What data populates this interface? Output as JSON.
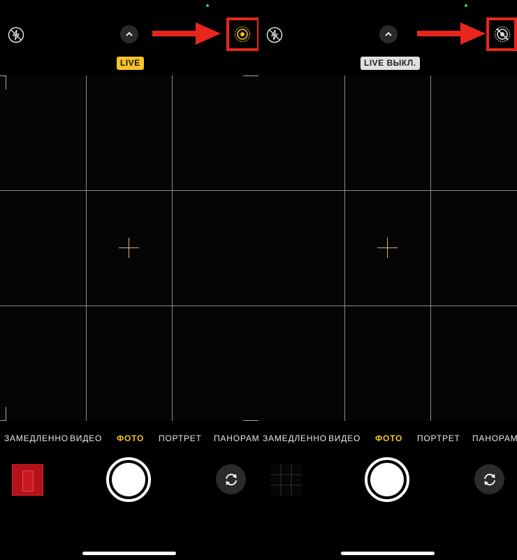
{
  "left": {
    "live_badge": "LIVE",
    "modes": [
      "ЗАМЕДЛЕННО",
      "ВИДЕО",
      "ФОТО",
      "ПОРТРЕТ",
      "ПАНОРАМА"
    ],
    "active_mode": "ФОТО"
  },
  "right": {
    "live_badge": "LIVE ВЫКЛ.",
    "modes": [
      "ЗАМЕДЛЕННО",
      "ВИДЕО",
      "ФОТО",
      "ПОРТРЕТ",
      "ПАНОРАМА"
    ],
    "active_mode": "ФОТО"
  },
  "icons": {
    "flash": "flash-off-icon",
    "chevron": "chevron-up-icon",
    "live_on": "live-photo-on-icon",
    "live_off": "live-photo-off-icon",
    "flip": "camera-flip-icon"
  },
  "colors": {
    "accent_yellow": "#f7c22b",
    "annotation_red": "#e8261b",
    "privacy_dot": "#30d158"
  }
}
